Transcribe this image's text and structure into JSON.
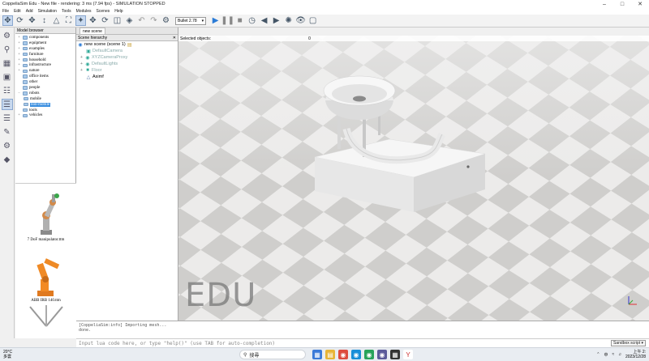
{
  "window": {
    "title": "CoppeliaSim Edu - New file - rendering: 3 ms (7.94 fps) - SIMULATION STOPPED"
  },
  "menu": [
    "File",
    "Edit",
    "Add",
    "Simulation",
    "Tools",
    "Modules",
    "Scenes",
    "Help"
  ],
  "toolbar": {
    "engine_label": "Bullet 2.78",
    "engine_caret": "▾"
  },
  "model_browser": {
    "header": "Model browser",
    "items": [
      {
        "label": "components"
      },
      {
        "label": "equipment"
      },
      {
        "label": "examples"
      },
      {
        "label": "furniture"
      },
      {
        "label": "household"
      },
      {
        "label": "infrastructure"
      },
      {
        "label": "nature"
      },
      {
        "label": "office items"
      },
      {
        "label": "other"
      },
      {
        "label": "people"
      },
      {
        "label": "robots"
      },
      {
        "label": "mobile"
      },
      {
        "label": "non-mobile"
      },
      {
        "label": "tools"
      },
      {
        "label": "vehicles"
      }
    ],
    "thumbnails": [
      {
        "caption": "7 DoF manipulator.ttm"
      },
      {
        "caption": "ABB IRB 140.ttm"
      }
    ]
  },
  "scene": {
    "tab": "new scene",
    "header": "Scene hierarchy",
    "root": "new scene (scene 1)",
    "items": [
      {
        "label": "DefaultCamera"
      },
      {
        "label": "XYZCameraProxy"
      },
      {
        "label": "DefaultLights"
      },
      {
        "label": "Floor"
      },
      {
        "label": "Asimf"
      }
    ]
  },
  "viewport": {
    "selected_label": "Selected objects:",
    "selected_count": "0",
    "watermark": "EDU"
  },
  "console": {
    "lines": [
      "[CoppeliaSim:info]   Importing mesh...",
      "done."
    ],
    "input_placeholder": "Input lua code here, or type \"help()\" (use TAB for auto-completion)",
    "sandbox_label": "Sandbox script ▾"
  },
  "taskbar": {
    "weather_temp": "20°C",
    "weather_desc": "多雲",
    "search_label": "搜尋",
    "time": "上午 2:",
    "date": "2023/12/28"
  },
  "colors": {
    "accent": "#3b8fe0",
    "selection": "#c8d9ef",
    "play": "#2b7bd6"
  }
}
